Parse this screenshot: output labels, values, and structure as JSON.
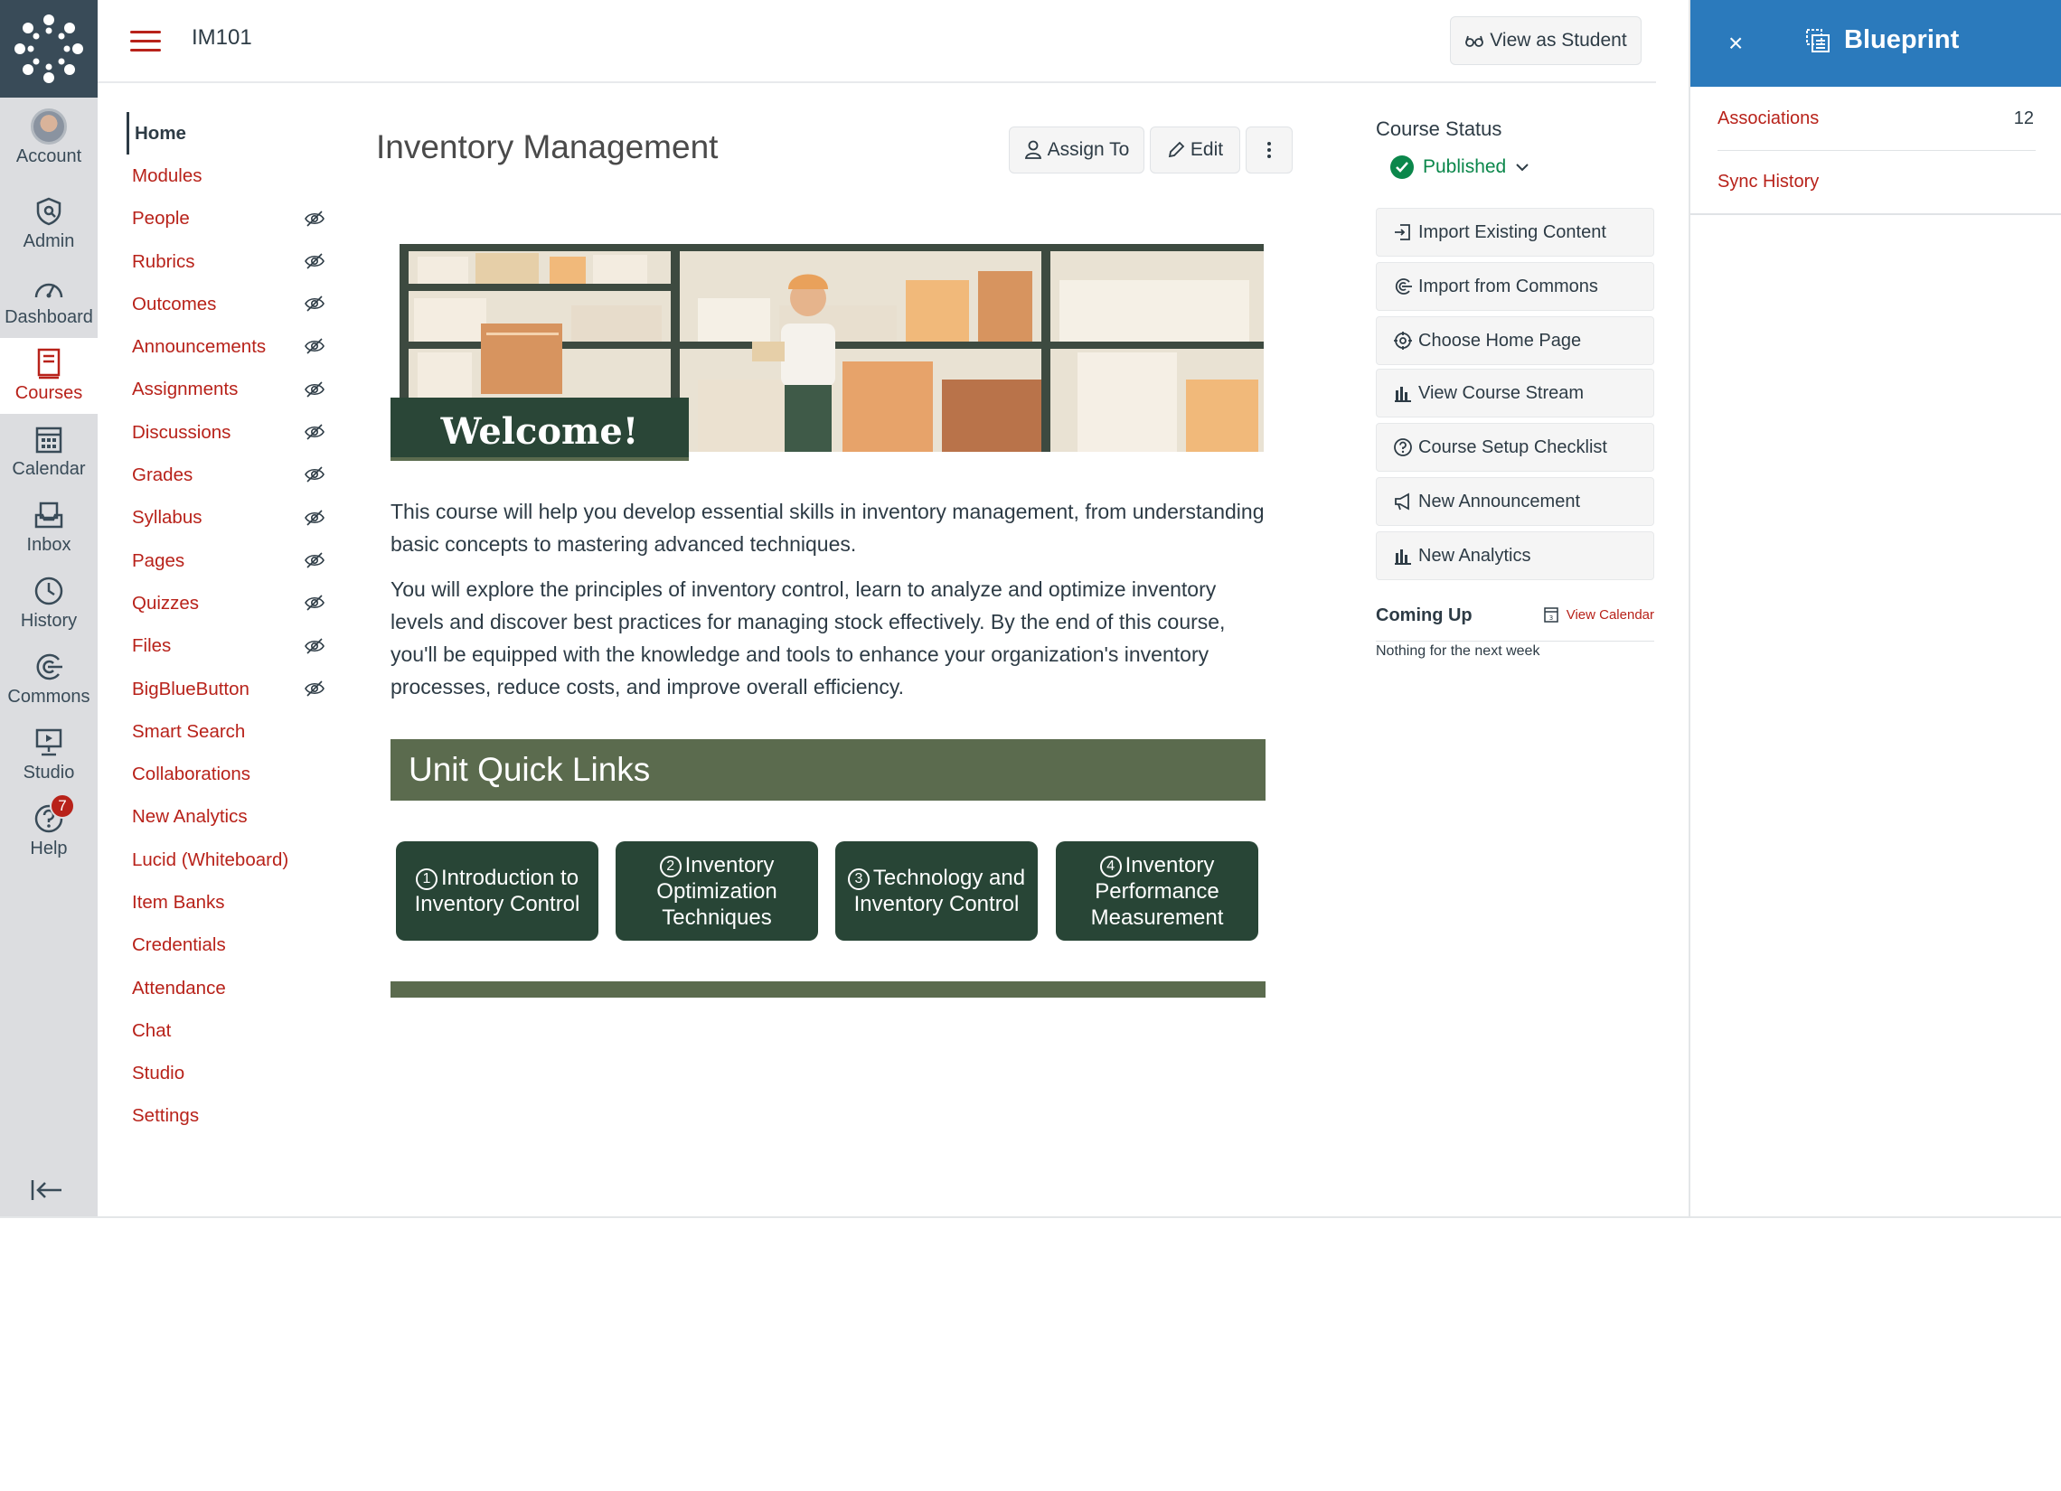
{
  "global_nav": {
    "items": [
      {
        "label": "Account",
        "icon": "account-avatar"
      },
      {
        "label": "Admin",
        "icon": "shield-icon"
      },
      {
        "label": "Dashboard",
        "icon": "dashboard-icon"
      },
      {
        "label": "Courses",
        "icon": "courses-icon"
      },
      {
        "label": "Calendar",
        "icon": "calendar-icon"
      },
      {
        "label": "Inbox",
        "icon": "inbox-icon"
      },
      {
        "label": "History",
        "icon": "clock-icon"
      },
      {
        "label": "Commons",
        "icon": "commons-icon"
      },
      {
        "label": "Studio",
        "icon": "studio-icon"
      },
      {
        "label": "Help",
        "icon": "help-icon"
      }
    ],
    "help_badge": "7",
    "active": "Courses"
  },
  "header": {
    "course_code": "IM101",
    "view_as_student": "View as Student"
  },
  "course_nav": {
    "items": [
      {
        "label": "Home",
        "hidden": false
      },
      {
        "label": "Modules",
        "hidden": false
      },
      {
        "label": "People",
        "hidden": true
      },
      {
        "label": "Rubrics",
        "hidden": true
      },
      {
        "label": "Outcomes",
        "hidden": true
      },
      {
        "label": "Announcements",
        "hidden": true
      },
      {
        "label": "Assignments",
        "hidden": true
      },
      {
        "label": "Discussions",
        "hidden": true
      },
      {
        "label": "Grades",
        "hidden": true
      },
      {
        "label": "Syllabus",
        "hidden": true
      },
      {
        "label": "Pages",
        "hidden": true
      },
      {
        "label": "Quizzes",
        "hidden": true
      },
      {
        "label": "Files",
        "hidden": true
      },
      {
        "label": "BigBlueButton",
        "hidden": true
      },
      {
        "label": "Smart Search",
        "hidden": false
      },
      {
        "label": "Collaborations",
        "hidden": false
      },
      {
        "label": "New Analytics",
        "hidden": false
      },
      {
        "label": "Lucid (Whiteboard)",
        "hidden": false
      },
      {
        "label": "Item Banks",
        "hidden": false
      },
      {
        "label": "Credentials",
        "hidden": false
      },
      {
        "label": "Attendance",
        "hidden": false
      },
      {
        "label": "Chat",
        "hidden": false
      },
      {
        "label": "Studio",
        "hidden": false
      },
      {
        "label": "Settings",
        "hidden": false
      }
    ]
  },
  "main": {
    "title": "Inventory Management",
    "assign_to": "Assign To",
    "edit": "Edit",
    "banner_text": "Welcome!",
    "paragraph1": "This course will help you develop essential skills in inventory management, from understanding basic concepts to mastering advanced techniques.",
    "paragraph2": "You will explore the principles of inventory control, learn to analyze and optimize inventory levels and discover best practices for managing stock effectively. By the end of this course, you'll be equipped with the knowledge and tools to enhance your organization's inventory processes, reduce costs, and improve overall efficiency.",
    "unit_header": "Unit Quick Links",
    "quick_links": [
      {
        "num": "1",
        "label": "Introduction to Inventory Control"
      },
      {
        "num": "2",
        "label": "Inventory Optimization Techniques"
      },
      {
        "num": "3",
        "label": "Technology and Inventory Control"
      },
      {
        "num": "4",
        "label": "Inventory Performance Measurement"
      }
    ]
  },
  "sidebar": {
    "course_status_label": "Course Status",
    "status": "Published",
    "buttons": [
      {
        "label": "Import Existing Content",
        "icon": "import-icon"
      },
      {
        "label": "Import from Commons",
        "icon": "commons-icon"
      },
      {
        "label": "Choose Home Page",
        "icon": "target-icon"
      },
      {
        "label": "View Course Stream",
        "icon": "bar-chart-icon"
      },
      {
        "label": "Course Setup Checklist",
        "icon": "question-icon"
      },
      {
        "label": "New Announcement",
        "icon": "megaphone-icon"
      },
      {
        "label": "New Analytics",
        "icon": "bar-chart-icon"
      }
    ],
    "coming_up": "Coming Up",
    "view_calendar": "View Calendar",
    "nothing": "Nothing for the next week"
  },
  "blueprint": {
    "title": "Blueprint",
    "close": "×",
    "associations_label": "Associations",
    "associations_count": "12",
    "sync_history": "Sync History"
  },
  "colors": {
    "canvas_red": "#b8221a",
    "blueprint_blue": "#2b7abc",
    "unit_green": "#5b6b4e",
    "link_green": "#284536",
    "published_green": "#0b874b"
  }
}
